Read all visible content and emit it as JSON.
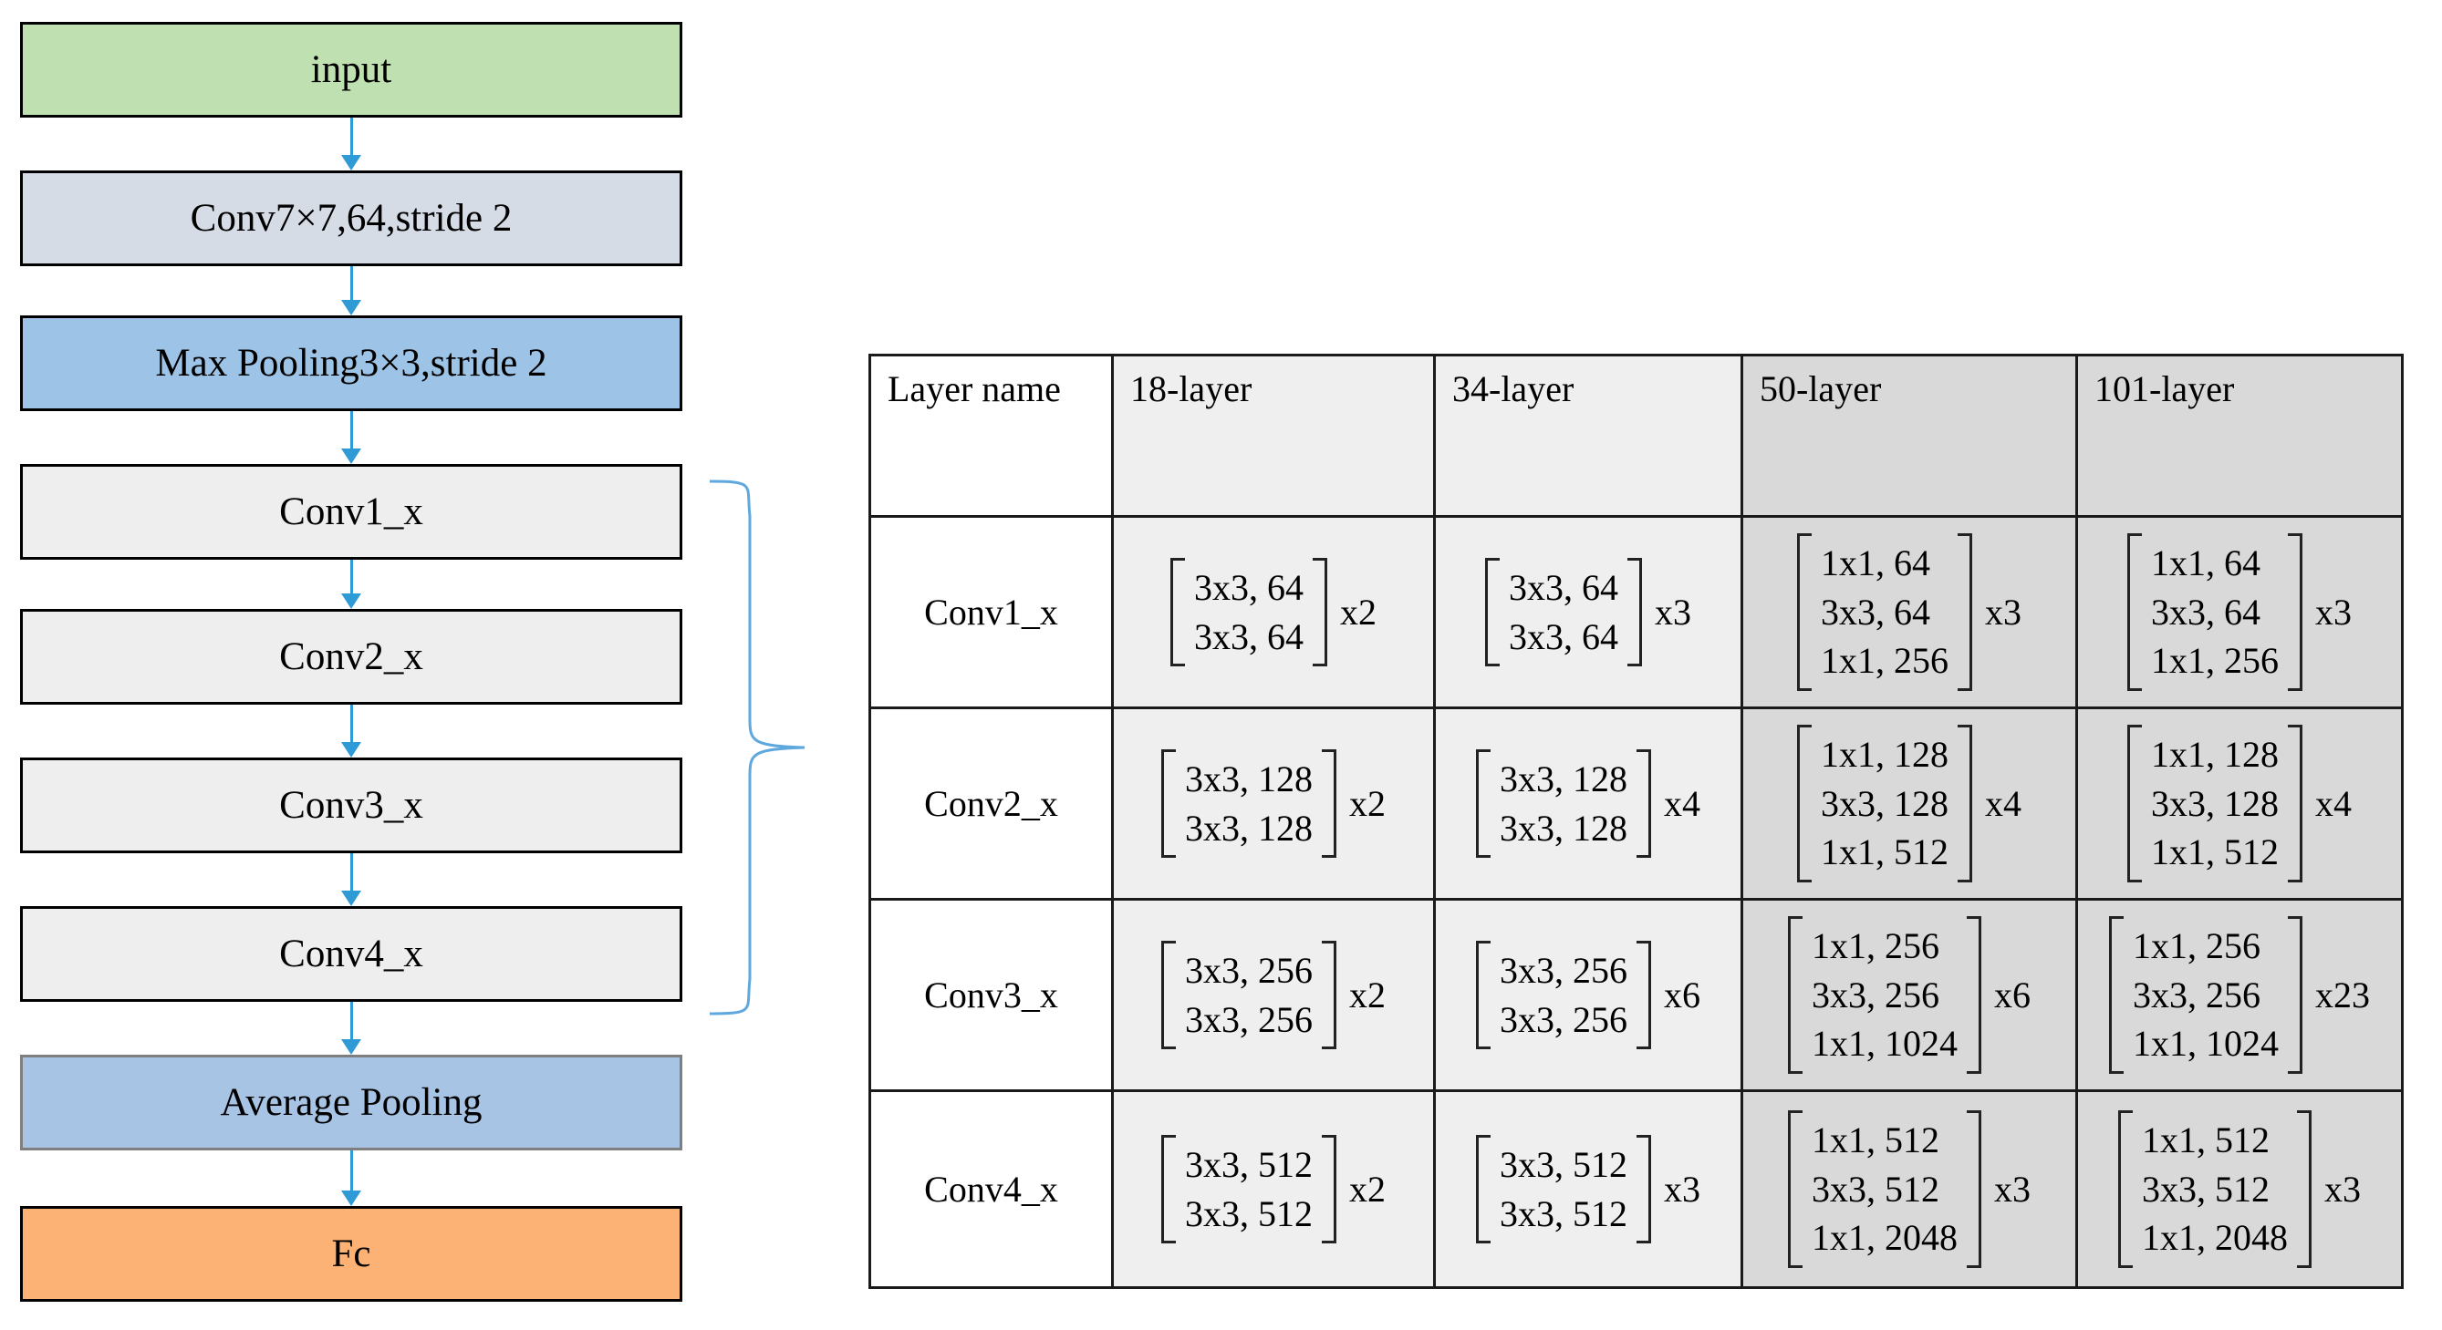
{
  "diagram": {
    "title": "ResNet architecture flowchart and layer configuration table",
    "accent_arrow_color": "#2e9bd6",
    "flow": {
      "nodes": [
        {
          "id": "input",
          "label": "input",
          "fill": "#bfe0b0",
          "border": "#000000"
        },
        {
          "id": "conv7x7",
          "label": "Conv7×7,64,stride 2",
          "fill": "#d6dce5",
          "border": "#000000"
        },
        {
          "id": "maxpool",
          "label": "Max Pooling3×3,stride 2",
          "fill": "#9dc3e6",
          "border": "#000000"
        },
        {
          "id": "conv1_x",
          "label": "Conv1_x",
          "fill": "#eeeeee",
          "border": "#000000"
        },
        {
          "id": "conv2_x",
          "label": "Conv2_x",
          "fill": "#eeeeee",
          "border": "#000000"
        },
        {
          "id": "conv3_x",
          "label": "Conv3_x",
          "fill": "#eeeeee",
          "border": "#000000"
        },
        {
          "id": "conv4_x",
          "label": "Conv4_x",
          "fill": "#eeeeee",
          "border": "#000000"
        },
        {
          "id": "avgpool",
          "label": "Average Pooling",
          "fill": "#a8c4e5",
          "border": "#7f7f7f"
        },
        {
          "id": "fc",
          "label": "Fc",
          "fill": "#fbb274",
          "border": "#000000"
        }
      ],
      "edges": [
        {
          "from": "input",
          "to": "conv7x7"
        },
        {
          "from": "conv7x7",
          "to": "maxpool"
        },
        {
          "from": "maxpool",
          "to": "conv1_x"
        },
        {
          "from": "conv1_x",
          "to": "conv2_x"
        },
        {
          "from": "conv2_x",
          "to": "conv3_x"
        },
        {
          "from": "conv3_x",
          "to": "conv4_x"
        },
        {
          "from": "conv4_x",
          "to": "avgpool"
        },
        {
          "from": "avgpool",
          "to": "fc"
        }
      ],
      "brace": {
        "spans_from": "conv1_x",
        "spans_to": "conv4_x",
        "color": "#5fa8dd"
      }
    }
  },
  "chart_data": {
    "type": "table",
    "title": "ResNet layer configurations",
    "columns": [
      "Layer name",
      "18-layer",
      "34-layer",
      "50-layer",
      "101-layer"
    ],
    "column_shading": [
      "#ffffff",
      "#efefef",
      "#efefef",
      "#d9d9d9",
      "#d9d9d9"
    ],
    "rows": [
      {
        "name": "Conv1_x",
        "cells": [
          {
            "block": [
              "3x3, 64",
              "3x3, 64"
            ],
            "repeat": "x2"
          },
          {
            "block": [
              "3x3, 64",
              "3x3, 64"
            ],
            "repeat": "x3"
          },
          {
            "block": [
              "1x1, 64",
              "3x3, 64",
              "1x1, 256"
            ],
            "repeat": "x3"
          },
          {
            "block": [
              "1x1, 64",
              "3x3, 64",
              "1x1, 256"
            ],
            "repeat": "x3"
          }
        ]
      },
      {
        "name": "Conv2_x",
        "cells": [
          {
            "block": [
              "3x3, 128",
              "3x3, 128"
            ],
            "repeat": "x2"
          },
          {
            "block": [
              "3x3, 128",
              "3x3, 128"
            ],
            "repeat": "x4"
          },
          {
            "block": [
              "1x1, 128",
              "3x3, 128",
              "1x1, 512"
            ],
            "repeat": "x4"
          },
          {
            "block": [
              "1x1, 128",
              "3x3, 128",
              "1x1, 512"
            ],
            "repeat": "x4"
          }
        ]
      },
      {
        "name": "Conv3_x",
        "cells": [
          {
            "block": [
              "3x3, 256",
              "3x3, 256"
            ],
            "repeat": "x2"
          },
          {
            "block": [
              "3x3, 256",
              "3x3, 256"
            ],
            "repeat": "x6"
          },
          {
            "block": [
              "1x1, 256",
              "3x3, 256",
              "1x1, 1024"
            ],
            "repeat": "x6"
          },
          {
            "block": [
              "1x1, 256",
              "3x3, 256",
              "1x1, 1024"
            ],
            "repeat": "x23"
          }
        ]
      },
      {
        "name": "Conv4_x",
        "cells": [
          {
            "block": [
              "3x3, 512",
              "3x3, 512"
            ],
            "repeat": "x2"
          },
          {
            "block": [
              "3x3, 512",
              "3x3, 512"
            ],
            "repeat": "x3"
          },
          {
            "block": [
              "1x1, 512",
              "3x3, 512",
              "1x1, 2048"
            ],
            "repeat": "x3"
          },
          {
            "block": [
              "1x1, 512",
              "3x3, 512",
              "1x1, 2048"
            ],
            "repeat": "x3"
          }
        ]
      }
    ]
  }
}
